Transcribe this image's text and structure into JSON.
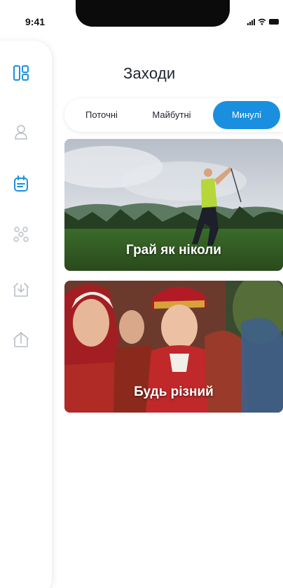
{
  "status": {
    "time": "9:41"
  },
  "sidebar": {
    "items": [
      {
        "icon": "dashboard-icon",
        "active": true
      },
      {
        "icon": "user-icon",
        "active": false
      },
      {
        "icon": "events-icon",
        "active": true
      },
      {
        "icon": "group-icon",
        "active": false
      },
      {
        "icon": "gift-icon",
        "active": false
      },
      {
        "icon": "upload-gift-icon",
        "active": false
      }
    ]
  },
  "header": {
    "title": "Заходи"
  },
  "tabs": [
    {
      "label": "Поточні"
    },
    {
      "label": "Майбутні"
    },
    {
      "label": "Минулі"
    }
  ],
  "events": [
    {
      "title": "Грай як ніколи"
    },
    {
      "title": "Будь різний"
    }
  ],
  "colors": {
    "accent": "#1a8fe0",
    "icon_inactive": "#b9bec8"
  }
}
